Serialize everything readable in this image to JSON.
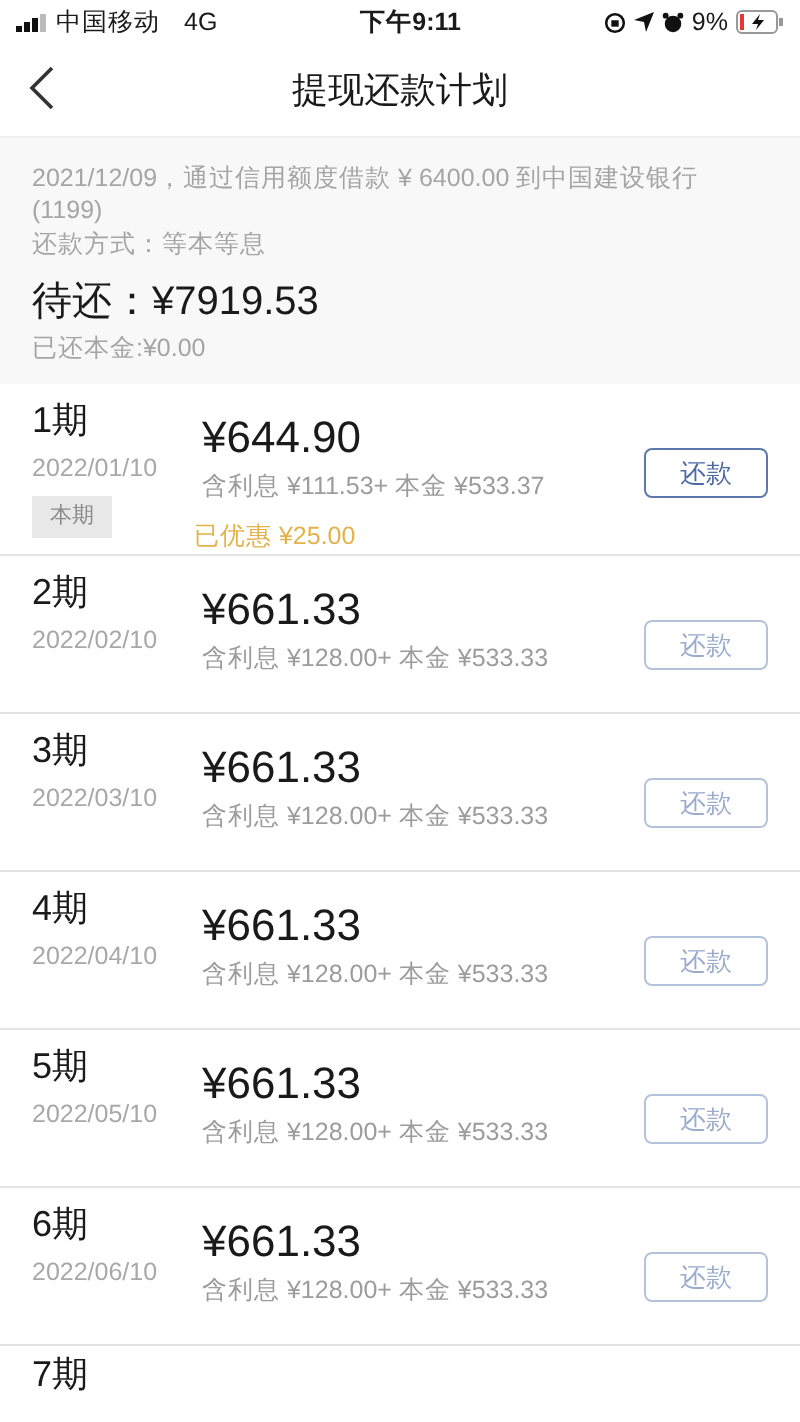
{
  "status_bar": {
    "carrier": "中国移动",
    "network": "4G",
    "time": "下午9:11",
    "battery": "9%"
  },
  "nav": {
    "title": "提现还款计划"
  },
  "summary": {
    "loan_text": "2021/12/09，通过信用额度借款 ¥ 6400.00 到中国建设银行(1199)",
    "method": "还款方式：等本等息",
    "pending_label": "待还：",
    "pending_amount": "¥7919.53",
    "paid_principal": "已还本金:¥0.00"
  },
  "installments": [
    {
      "period": "1期",
      "date": "2022/01/10",
      "tag": "本期",
      "amount": "¥644.90",
      "detail": "含利息 ¥111.53+ 本金 ¥533.37",
      "discount": "已优惠 ¥25.00",
      "button": {
        "label": "还款",
        "disabled": false
      }
    },
    {
      "period": "2期",
      "date": "2022/02/10",
      "amount": "¥661.33",
      "detail": "含利息 ¥128.00+ 本金 ¥533.33",
      "button": {
        "label": "还款",
        "disabled": true
      }
    },
    {
      "period": "3期",
      "date": "2022/03/10",
      "amount": "¥661.33",
      "detail": "含利息 ¥128.00+ 本金 ¥533.33",
      "button": {
        "label": "还款",
        "disabled": true
      }
    },
    {
      "period": "4期",
      "date": "2022/04/10",
      "amount": "¥661.33",
      "detail": "含利息 ¥128.00+ 本金 ¥533.33",
      "button": {
        "label": "还款",
        "disabled": true
      }
    },
    {
      "period": "5期",
      "date": "2022/05/10",
      "amount": "¥661.33",
      "detail": "含利息 ¥128.00+ 本金 ¥533.33",
      "button": {
        "label": "还款",
        "disabled": true
      }
    },
    {
      "period": "6期",
      "date": "2022/06/10",
      "amount": "¥661.33",
      "detail": "含利息 ¥128.00+ 本金 ¥533.33",
      "button": {
        "label": "还款",
        "disabled": true
      }
    },
    {
      "period": "7期"
    }
  ]
}
